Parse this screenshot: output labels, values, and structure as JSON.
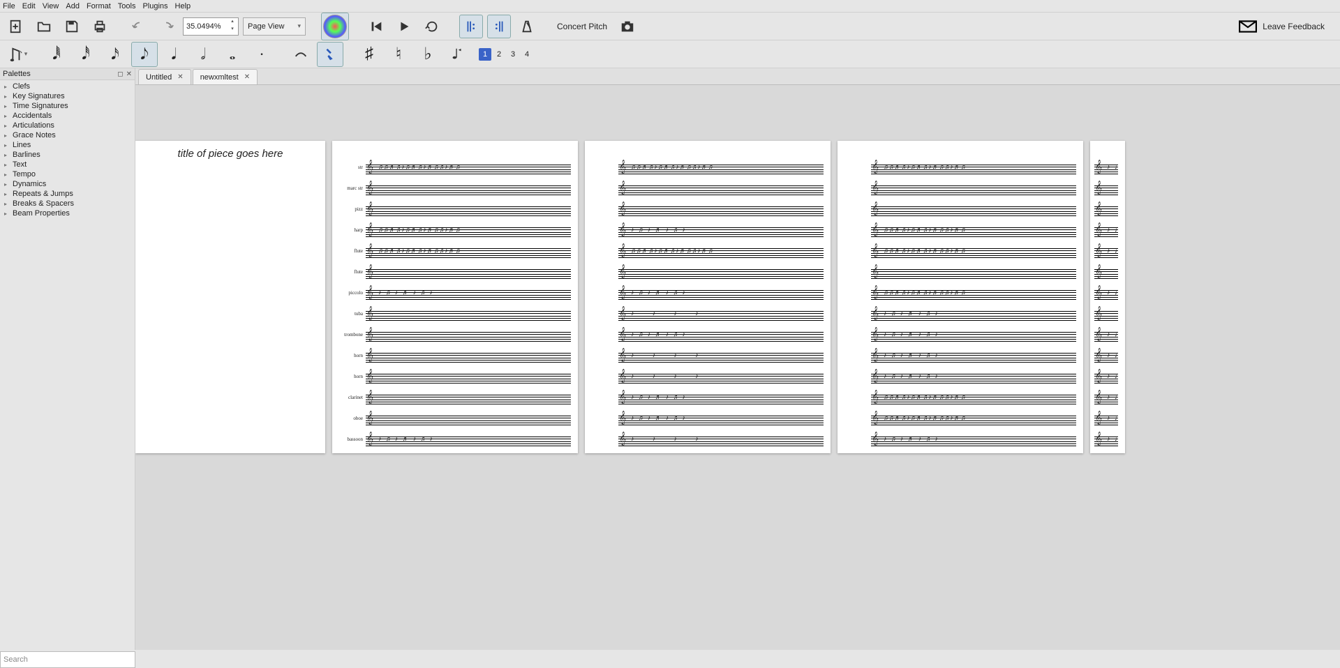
{
  "menubar": [
    "File",
    "Edit",
    "View",
    "Add",
    "Format",
    "Tools",
    "Plugins",
    "Help"
  ],
  "toolbar": {
    "zoom_value": "35.0494%",
    "view_mode": "Page View",
    "concert_pitch_label": "Concert Pitch",
    "feedback_label": "Leave Feedback"
  },
  "voices": [
    "1",
    "2",
    "3",
    "4"
  ],
  "active_voice": 0,
  "palettes": {
    "title": "Palettes",
    "items": [
      "Clefs",
      "Key Signatures",
      "Time Signatures",
      "Accidentals",
      "Articulations",
      "Grace Notes",
      "Lines",
      "Barlines",
      "Text",
      "Tempo",
      "Dynamics",
      "Repeats & Jumps",
      "Breaks & Spacers",
      "Beam Properties"
    ]
  },
  "search_placeholder": "Search",
  "tabs": [
    {
      "label": "Untitled",
      "active": false
    },
    {
      "label": "newxmltest",
      "active": true
    }
  ],
  "score": {
    "title": "title of piece goes here",
    "instruments": [
      "str",
      "marc str",
      "pizz",
      "harp",
      "flute",
      "flute",
      "piccolo",
      "tuba",
      "trombone",
      "horn",
      "horn",
      "clarinet",
      "oboe",
      "bassoon"
    ]
  }
}
